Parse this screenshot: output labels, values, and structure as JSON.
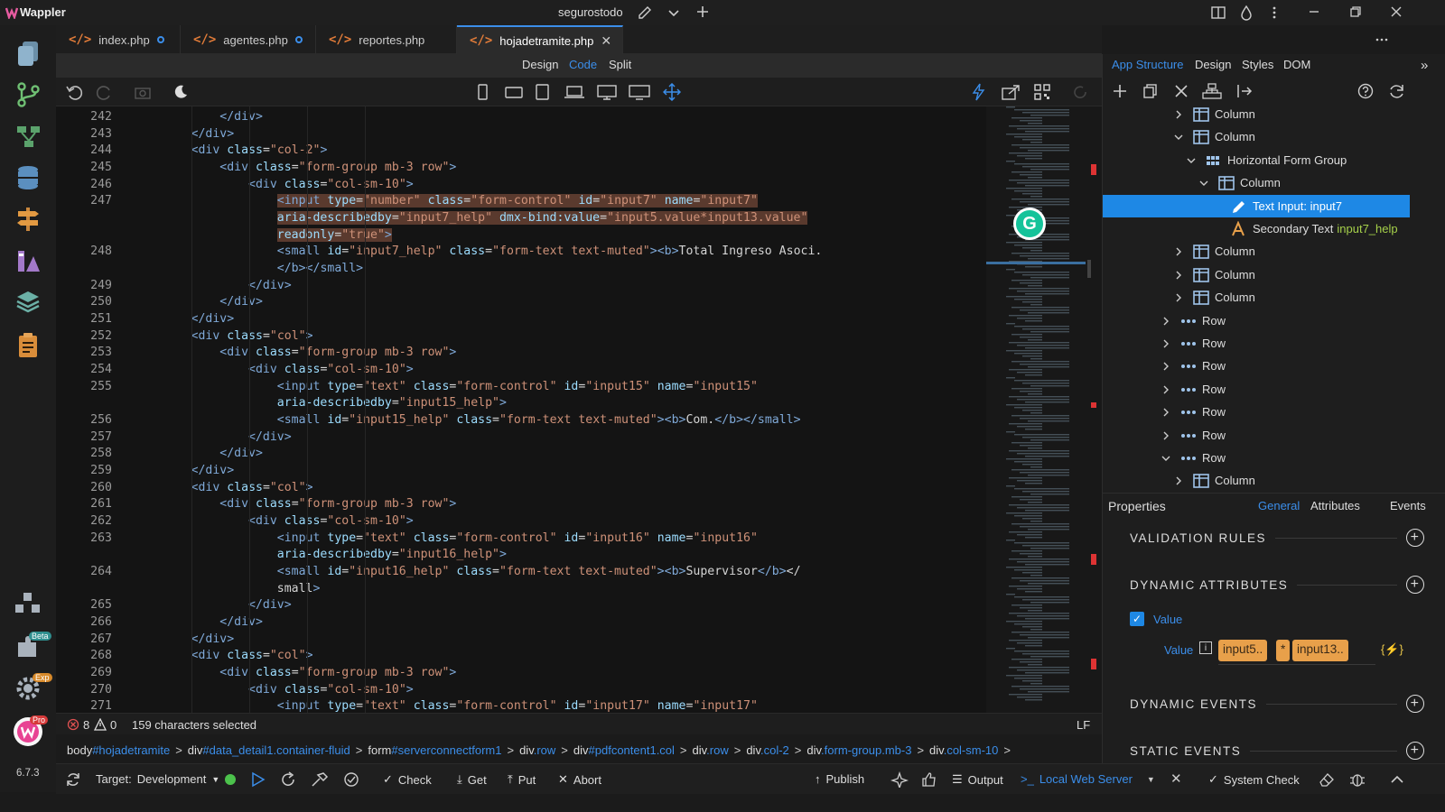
{
  "app": {
    "name": "Wappler",
    "project": "segurostodo",
    "version": "6.7.3",
    "beta_badge": "Beta",
    "exp_badge": "Exp",
    "pro_badge": "Pro"
  },
  "tabs": [
    {
      "label": "index.php",
      "modified": true
    },
    {
      "label": "agentes.php",
      "modified": true
    },
    {
      "label": "reportes.php",
      "modified": false
    },
    {
      "label": "hojadetramite.php",
      "active": true
    }
  ],
  "views": {
    "design": "Design",
    "code": "Code",
    "split": "Split"
  },
  "editor": {
    "lines": [
      {
        "n": "242",
        "html": "            &lt;/div&gt;"
      },
      {
        "n": "243",
        "html": "        &lt;/div&gt;"
      },
      {
        "n": "244",
        "html": "        &lt;div class=\"col-2\"&gt;"
      },
      {
        "n": "245",
        "html": "            &lt;div class=\"form-group mb-3 row\"&gt;"
      },
      {
        "n": "246",
        "html": "                &lt;div class=\"col-sm-10\"&gt;"
      },
      {
        "n": "247",
        "html": "                    &lt;input type=\"number\" class=\"form-control\" id=\"input7\" name=\"input7\""
      },
      {
        "n": "",
        "html": "                    aria-describedby=\"input7_help\" dmx-bind:value=\"input5.value*input13.value\""
      },
      {
        "n": "",
        "html": "                    readonly=\"true\"&gt;"
      },
      {
        "n": "248",
        "html": "                    &lt;small id=\"input7_help\" class=\"form-text text-muted\"&gt;&lt;b&gt;Total Ingreso Asoci."
      },
      {
        "n": "",
        "html": "                    &lt;/b&gt;&lt;/small&gt;"
      },
      {
        "n": "249",
        "html": "                &lt;/div&gt;"
      },
      {
        "n": "250",
        "html": "            &lt;/div&gt;"
      },
      {
        "n": "251",
        "html": "        &lt;/div&gt;"
      },
      {
        "n": "252",
        "html": "        &lt;div class=\"col\"&gt;"
      },
      {
        "n": "253",
        "html": "            &lt;div class=\"form-group mb-3 row\"&gt;"
      },
      {
        "n": "254",
        "html": "                &lt;div class=\"col-sm-10\"&gt;"
      },
      {
        "n": "255",
        "html": "                    &lt;input type=\"text\" class=\"form-control\" id=\"input15\" name=\"input15\""
      },
      {
        "n": "",
        "html": "                    aria-describedby=\"input15_help\"&gt;"
      },
      {
        "n": "256",
        "html": "                    &lt;small id=\"input15_help\" class=\"form-text text-muted\"&gt;&lt;b&gt;Com.&lt;/b&gt;&lt;/small&gt;"
      },
      {
        "n": "257",
        "html": "                &lt;/div&gt;"
      },
      {
        "n": "258",
        "html": "            &lt;/div&gt;"
      },
      {
        "n": "259",
        "html": "        &lt;/div&gt;"
      },
      {
        "n": "260",
        "html": "        &lt;div class=\"col\"&gt;"
      },
      {
        "n": "261",
        "html": "            &lt;div class=\"form-group mb-3 row\"&gt;"
      },
      {
        "n": "262",
        "html": "                &lt;div class=\"col-sm-10\"&gt;"
      },
      {
        "n": "263",
        "html": "                    &lt;input type=\"text\" class=\"form-control\" id=\"input16\" name=\"input16\""
      },
      {
        "n": "",
        "html": "                    aria-describedby=\"input16_help\"&gt;"
      },
      {
        "n": "264",
        "html": "                    &lt;small id=\"input16_help\" class=\"form-text text-muted\"&gt;&lt;b&gt;Supervisor&lt;/b&gt;&lt;/"
      },
      {
        "n": "",
        "html": "                    small&gt;"
      },
      {
        "n": "265",
        "html": "                &lt;/div&gt;"
      },
      {
        "n": "266",
        "html": "            &lt;/div&gt;"
      },
      {
        "n": "267",
        "html": "        &lt;/div&gt;"
      },
      {
        "n": "268",
        "html": "        &lt;div class=\"col\"&gt;"
      },
      {
        "n": "269",
        "html": "            &lt;div class=\"form-group mb-3 row\"&gt;"
      },
      {
        "n": "270",
        "html": "                &lt;div class=\"col-sm-10\"&gt;"
      },
      {
        "n": "271",
        "html": "                    &lt;input type=\"text\" class=\"form-control\" id=\"input17\" name=\"input17\""
      }
    ]
  },
  "status": {
    "errors": "8",
    "warnings": "0",
    "selection": "159 characters selected",
    "eol": "LF"
  },
  "breadcrumb": [
    {
      "tag": "body",
      "sel": "#hojadetramite"
    },
    {
      "tag": "div",
      "sel": "#data_detail1.container-fluid"
    },
    {
      "tag": "form",
      "sel": "#serverconnectform1"
    },
    {
      "tag": "div",
      "sel": ".row"
    },
    {
      "tag": "div",
      "sel": "#pdfcontent1.col"
    },
    {
      "tag": "div",
      "sel": ".row"
    },
    {
      "tag": "div",
      "sel": ".col-2"
    },
    {
      "tag": "div",
      "sel": ".form-group.mb-3"
    },
    {
      "tag": "div",
      "sel": ".col-sm-10"
    }
  ],
  "bottom": {
    "target_label": "Target:",
    "target": "Development",
    "check": "Check",
    "get": "Get",
    "put": "Put",
    "abort": "Abort",
    "publish": "Publish",
    "output": "Output",
    "server": "Local Web Server",
    "system_check": "System Check"
  },
  "panel": {
    "tabs": [
      "App Structure",
      "Design",
      "Styles",
      "DOM"
    ],
    "tree": [
      {
        "label": "Column",
        "icon": "column",
        "indent": 1,
        "expanded": false
      },
      {
        "label": "Column",
        "icon": "column",
        "indent": 1,
        "expanded": true
      },
      {
        "label": "Horizontal Form Group",
        "icon": "grid",
        "indent": 2,
        "expanded": true
      },
      {
        "label": "Column",
        "icon": "column",
        "indent": 3,
        "expanded": true
      },
      {
        "label": "Text Input: input7",
        "icon": "pencil",
        "indent": 4,
        "selected": true
      },
      {
        "label": "Secondary Text",
        "extra": "input7_help",
        "icon": "text",
        "indent": 4
      },
      {
        "label": "Column",
        "icon": "column",
        "indent": 1,
        "expanded": false
      },
      {
        "label": "Column",
        "icon": "column",
        "indent": 1,
        "expanded": false
      },
      {
        "label": "Column",
        "icon": "column",
        "indent": 1,
        "expanded": false
      },
      {
        "label": "Row",
        "icon": "dots",
        "indent": 0,
        "expanded": false
      },
      {
        "label": "Row",
        "icon": "dots",
        "indent": 0,
        "expanded": false
      },
      {
        "label": "Row",
        "icon": "dots",
        "indent": 0,
        "expanded": false
      },
      {
        "label": "Row",
        "icon": "dots",
        "indent": 0,
        "expanded": false
      },
      {
        "label": "Row",
        "icon": "dots",
        "indent": 0,
        "expanded": false
      },
      {
        "label": "Row",
        "icon": "dots",
        "indent": 0,
        "expanded": false
      },
      {
        "label": "Row",
        "icon": "dots",
        "indent": 0,
        "expanded": true
      },
      {
        "label": "Column",
        "icon": "column",
        "indent": 1,
        "expanded": false
      }
    ],
    "properties": {
      "title": "Properties",
      "tabs": [
        "General",
        "Attributes",
        "Events"
      ],
      "sections": [
        "VALIDATION RULES",
        "DYNAMIC ATTRIBUTES",
        "DYNAMIC EVENTS",
        "STATIC EVENTS"
      ],
      "value_checkbox": "Value",
      "value_label": "Value",
      "chips": [
        "input5..",
        "*",
        "input13.."
      ],
      "fx": "{⚡}"
    }
  },
  "colors": {
    "accent": "#3b8eea",
    "selected": "#1e88e5",
    "chip": "#e8a04a",
    "error": "#e05252"
  }
}
